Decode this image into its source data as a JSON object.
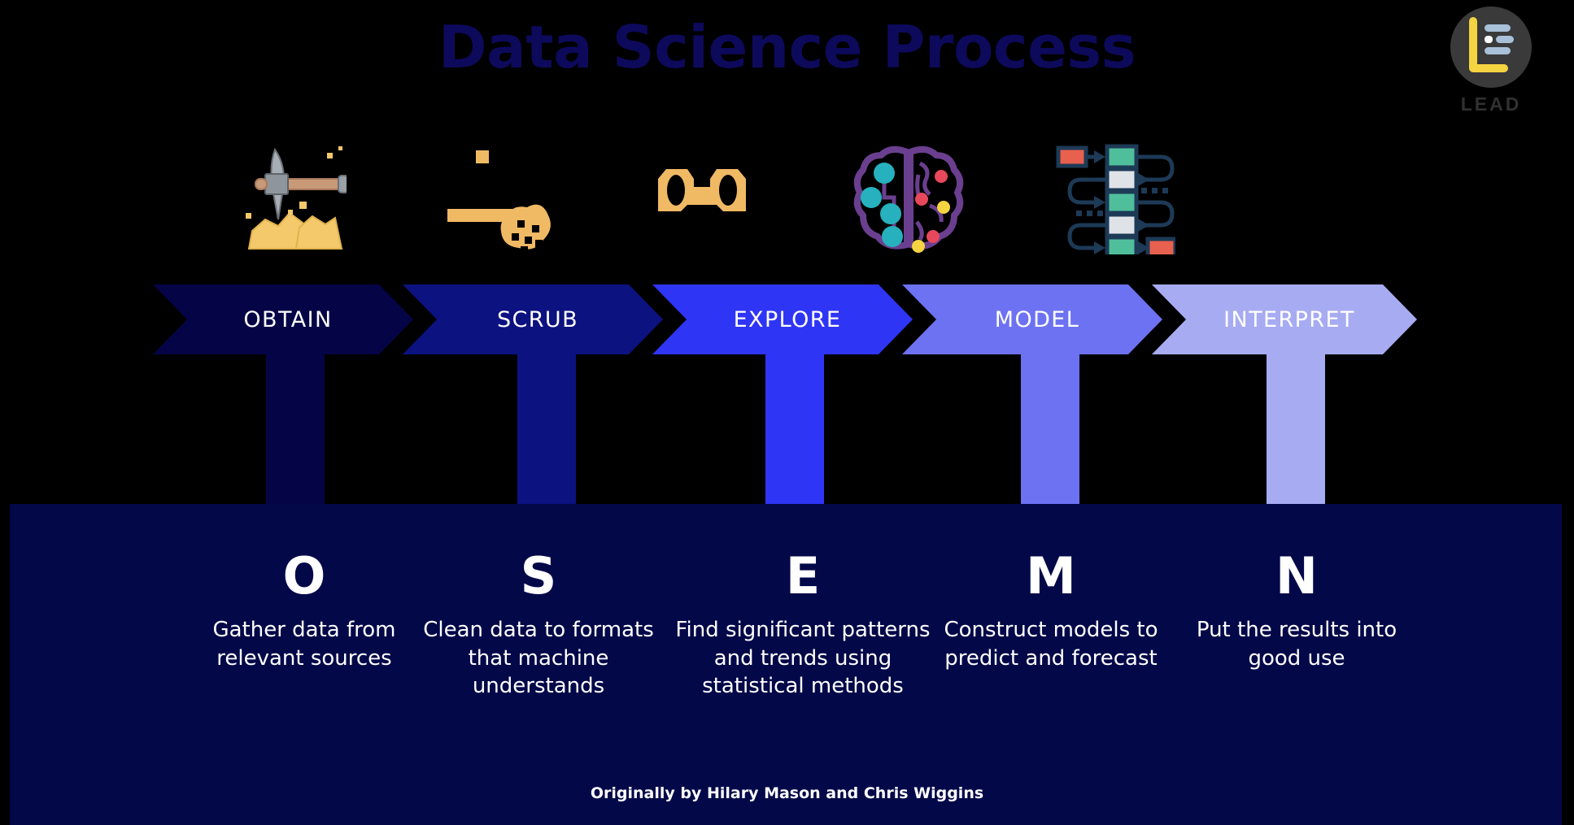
{
  "title": "Data Science Process",
  "logo": {
    "label": "LEAD",
    "icon": "lead-document-logo-icon",
    "circle_color": "#3a3a3a",
    "accent_color": "#f5d442",
    "bar_color": "#a8c0d8"
  },
  "credit": "Originally by Hilary Mason and Chris Wiggins",
  "colors": {
    "background": "#000000",
    "panel": "#030849",
    "title": "#0d0a5c",
    "text": "#ffffff"
  },
  "steps": [
    {
      "stage": "OBTAIN",
      "letter": "O",
      "description": "Gather data from relevant sources",
      "color": "#050446",
      "icon": "pickaxe-mining-icon"
    },
    {
      "stage": "SCRUB",
      "letter": "S",
      "description": "Clean data to formats that machine understands",
      "color": "#0c1280",
      "icon": "scrub-sponge-icon"
    },
    {
      "stage": "EXPLORE",
      "letter": "E",
      "description": "Find significant patterns and trends using statistical methods",
      "color": "#2f35f5",
      "icon": "binoculars-icon"
    },
    {
      "stage": "MODEL",
      "letter": "M",
      "description": "Construct models to predict and forecast",
      "color": "#6d72f2",
      "icon": "brain-network-icon"
    },
    {
      "stage": "INTERPRET",
      "letter": "N",
      "description": "Put the results into good use",
      "color": "#a7abf2",
      "icon": "workflow-diagram-icon"
    }
  ]
}
